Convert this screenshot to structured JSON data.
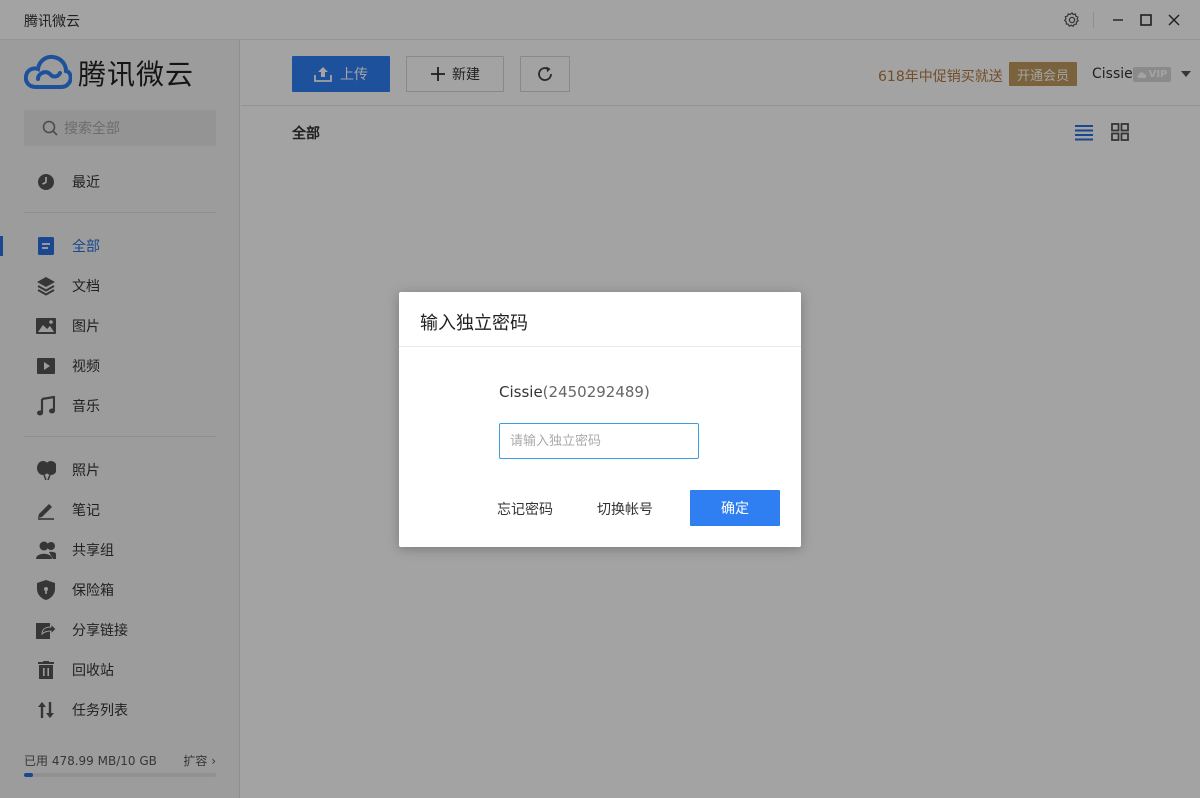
{
  "window": {
    "title": "腾讯微云",
    "icons": [
      "gear-icon",
      "minimize-icon",
      "maximize-icon",
      "close-icon"
    ]
  },
  "sidebar": {
    "logo_text": "腾讯微云",
    "search_placeholder": "搜索全部",
    "items": [
      {
        "label": "最近",
        "icon": "clock-icon"
      },
      {
        "label": "全部",
        "icon": "document-icon",
        "active": true
      },
      {
        "label": "文档",
        "icon": "layers-icon"
      },
      {
        "label": "图片",
        "icon": "image-icon"
      },
      {
        "label": "视频",
        "icon": "play-icon"
      },
      {
        "label": "音乐",
        "icon": "music-icon"
      },
      {
        "label": "照片",
        "icon": "balloons-icon"
      },
      {
        "label": "笔记",
        "icon": "pen-icon"
      },
      {
        "label": "共享组",
        "icon": "group-icon"
      },
      {
        "label": "保险箱",
        "icon": "shield-icon"
      },
      {
        "label": "分享链接",
        "icon": "share-icon"
      },
      {
        "label": "回收站",
        "icon": "trash-icon"
      },
      {
        "label": "任务列表",
        "icon": "transfer-icon"
      }
    ],
    "storage": {
      "text": "已用 478.99 MB/10 GB",
      "used_fraction": 0.047,
      "expand_label": "扩容"
    }
  },
  "toolbar": {
    "upload_label": "上传",
    "new_label": "新建",
    "promo_text": "618年中促销买就送",
    "vip_button": "开通会员",
    "username": "Cissie",
    "vip_badge": "VIP"
  },
  "main": {
    "breadcrumb": "全部"
  },
  "dialog": {
    "title": "输入独立密码",
    "account_name": "Cissie",
    "account_id": "(2450292489)",
    "password_placeholder": "请输入独立密码",
    "password_value": "",
    "forgot_label": "忘记密码",
    "switch_label": "切换帐号",
    "confirm_label": "确定"
  },
  "colors": {
    "accent": "#2f7ff2",
    "active_nav": "#2a6fe0",
    "promo": "#b5793f",
    "vip": "#bf9a5e"
  }
}
